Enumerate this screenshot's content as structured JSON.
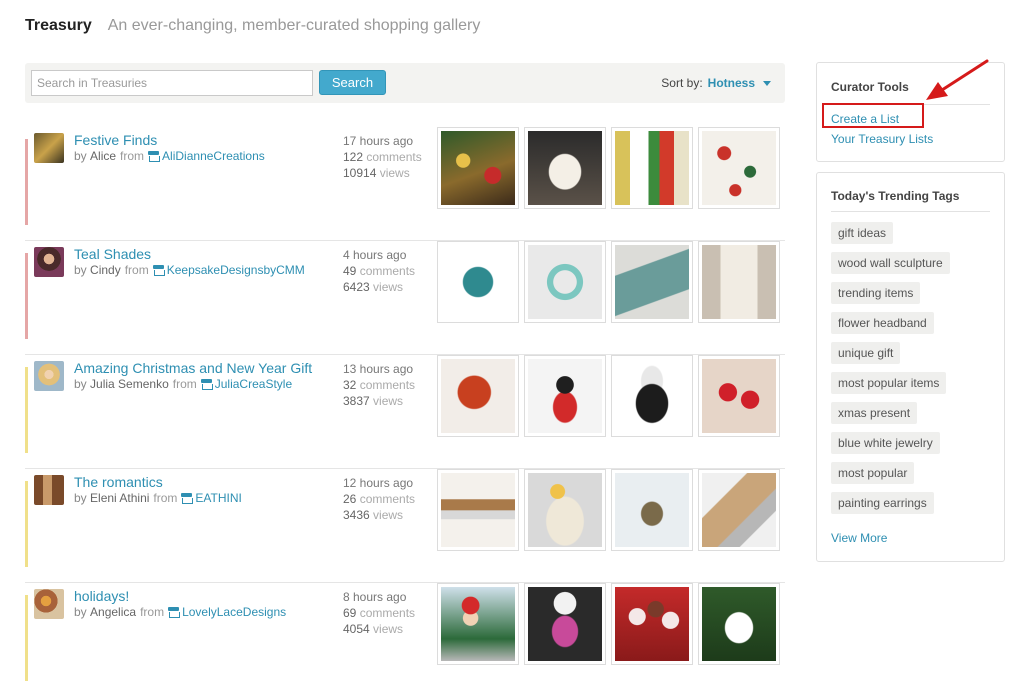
{
  "header": {
    "title": "Treasury",
    "subtitle": "An ever-changing, member-curated shopping gallery"
  },
  "search": {
    "placeholder": "Search in Treasuries",
    "button_label": "Search",
    "sort_label": "Sort by:",
    "sort_value": "Hotness"
  },
  "lists": [
    {
      "title": "Festive Finds",
      "by": "by",
      "author": "Alice",
      "from": "from",
      "shop": "AliDianneCreations",
      "time": "17 hours ago",
      "comments_count": "122",
      "comments_label": "comments",
      "views_count": "10914",
      "views_label": "views",
      "accent": "#e5a6a6",
      "thumbs": [
        "basket-with-ornaments",
        "white-bird-figurine",
        "painted-bird-art",
        "ornament-garland"
      ]
    },
    {
      "title": "Teal Shades",
      "by": "by",
      "author": "Cindy",
      "from": "from",
      "shop": "KeepsakeDesignsbyCMM",
      "time": "4 hours ago",
      "comments_count": "49",
      "comments_label": "comments",
      "views_count": "6423",
      "views_label": "views",
      "accent": "#e5a6a6",
      "thumbs": [
        "teal-leaf-pendant",
        "beaded-teal-necklace",
        "teal-necktie",
        "white-dress"
      ]
    },
    {
      "title": "Amazing Christmas and New Year Gift",
      "by": "by",
      "author": "Julia Semenko",
      "from": "from",
      "shop": "JuliaCreaStyle",
      "time": "13 hours ago",
      "comments_count": "32",
      "comments_label": "comments",
      "views_count": "3837",
      "views_label": "views",
      "accent": "#f0e08a",
      "thumbs": [
        "red-leaf-pendant",
        "ladybug-doll",
        "black-lace-collar",
        "red-rose-earrings"
      ]
    },
    {
      "title": "The romantics",
      "by": "by",
      "author": "Eleni Athini",
      "from": "from",
      "shop": "EATHINI",
      "time": "12 hours ago",
      "comments_count": "26",
      "comments_label": "comments",
      "views_count": "3436",
      "views_label": "views",
      "accent": "#f0e08a",
      "thumbs": [
        "leather-crystal-bracelet",
        "cream-clutch",
        "bird-necklace",
        "crystal-usb-drive"
      ]
    },
    {
      "title": "holidays!",
      "by": "by",
      "author": "Angelica",
      "from": "from",
      "shop": "LovelyLaceDesigns",
      "time": "8 hours ago",
      "comments_count": "69",
      "comments_label": "comments",
      "views_count": "4054",
      "views_label": "views",
      "accent": "#f0e08a",
      "thumbs": [
        "child-in-santa-hat",
        "pink-glass-pendant",
        "cake-pops",
        "lace-angel-ornament"
      ]
    }
  ],
  "curator_tools": {
    "title": "Curator Tools",
    "create_list": "Create a List",
    "your_lists": "Your Treasury Lists"
  },
  "trending": {
    "title": "Today's Trending Tags",
    "tags": [
      "gift ideas",
      "wood wall sculpture",
      "trending items",
      "flower headband",
      "unique gift",
      "most popular items",
      "xmas present",
      "blue white jewelry",
      "most popular",
      "painting earrings"
    ],
    "view_more": "View More"
  },
  "colors": {
    "link": "#2e8fb2",
    "button": "#43a9cd",
    "annotation_red": "#d51a1a"
  }
}
